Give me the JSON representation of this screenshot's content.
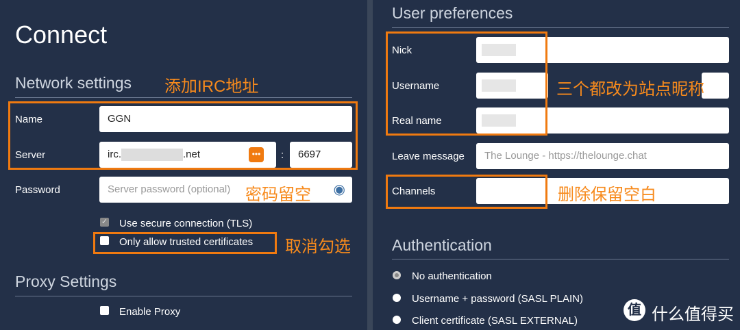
{
  "connect": {
    "title": "Connect",
    "network_settings": "Network settings",
    "name_label": "Name",
    "name_value": "GGN",
    "server_label": "Server",
    "server_prefix": "irc.",
    "server_suffix": ".net",
    "port_sep": ":",
    "port": "6697",
    "password_label": "Password",
    "password_placeholder": "Server password (optional)",
    "tls_label": "Use secure connection (TLS)",
    "tls_checked": true,
    "trusted_label": "Only allow trusted certificates",
    "trusted_checked": false,
    "proxy_settings": "Proxy Settings",
    "proxy_label": "Enable Proxy"
  },
  "prefs": {
    "title": "User preferences",
    "nick_label": "Nick",
    "username_label": "Username",
    "realname_label": "Real name",
    "leave_label": "Leave message",
    "leave_placeholder": "The Lounge - https://thelounge.chat",
    "channels_label": "Channels"
  },
  "auth": {
    "title": "Authentication",
    "options": [
      "No authentication",
      "Username + password (SASL PLAIN)",
      "Client certificate (SASL EXTERNAL)"
    ],
    "selected": 0
  },
  "annotations": {
    "add_irc": "添加IRC地址",
    "password_empty": "密码留空",
    "uncheck": "取消勾选",
    "nickname": "三个都改为站点昵称",
    "delete_blank": "删除保留空白"
  },
  "watermark": {
    "logo": "值",
    "text": "什么值得买"
  },
  "colors": {
    "accent": "#f07a10",
    "bg": "#233048"
  }
}
